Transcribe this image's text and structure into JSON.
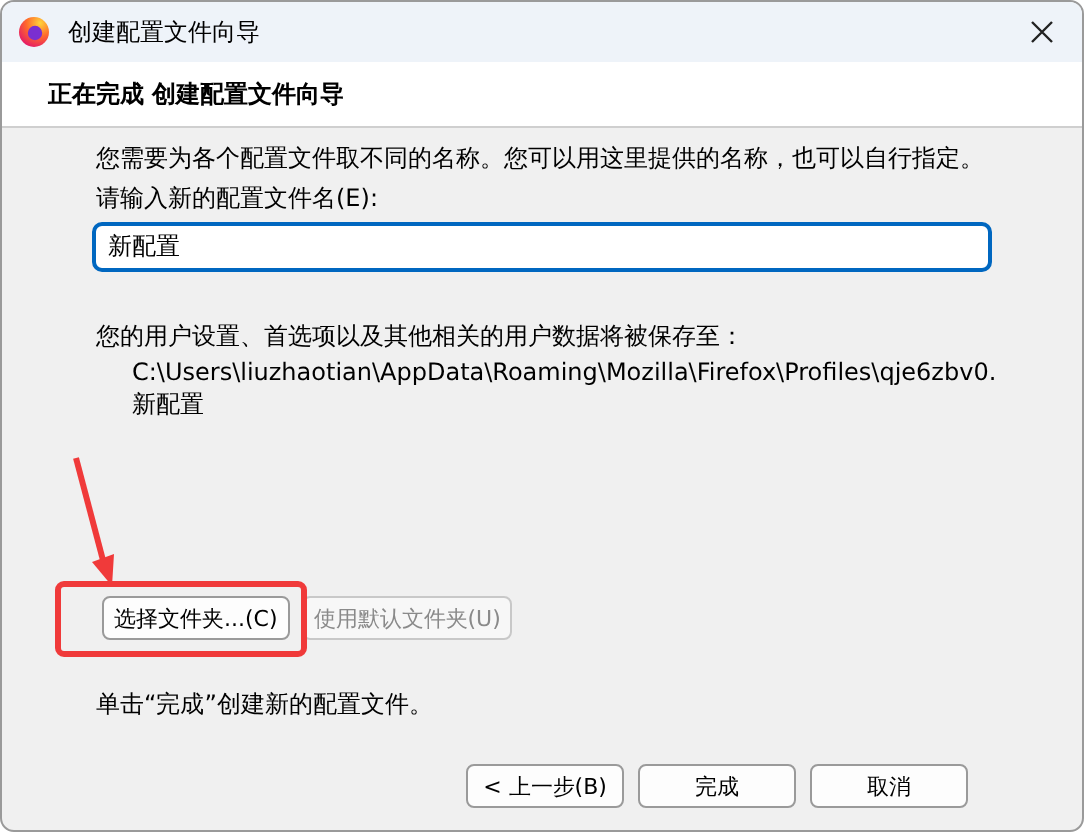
{
  "window": {
    "title": "创建配置文件向导"
  },
  "header": {
    "title": "正在完成 创建配置文件向导"
  },
  "intro": "您需要为各个配置文件取不同的名称。您可以用这里提供的名称，也可以自行指定。",
  "name_field": {
    "label": "请输入新的配置文件名(E):",
    "value": "新配置",
    "focused": true
  },
  "save_note": "您的用户设置、首选项以及其他相关的用户数据将被保存至：",
  "save_path": [
    "C:\\Users\\liuzhaotian\\AppData\\Roaming\\Mozilla\\Firefox\\Profiles\\qje6zbv0.",
    "新配置"
  ],
  "folder_buttons": [
    {
      "label": "选择文件夹...(C)",
      "disabled": false
    },
    {
      "label": "使用默认文件夹(U)",
      "disabled": true
    }
  ],
  "finish_note": "单击“完成”创建新的配置文件。",
  "buttons": [
    {
      "label": "< 上一步(B)"
    },
    {
      "label": "完成"
    },
    {
      "label": "取消"
    }
  ]
}
